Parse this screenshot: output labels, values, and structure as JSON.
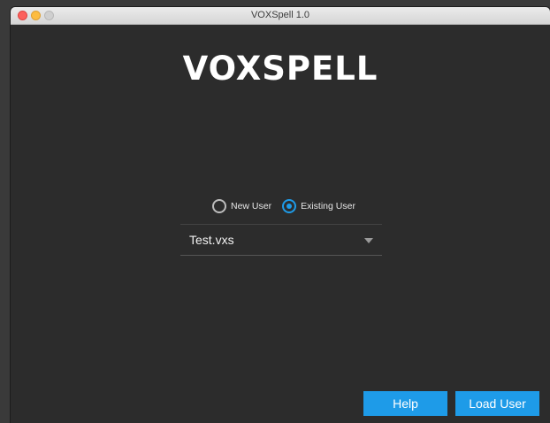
{
  "window": {
    "title": "VOXSpell 1.0"
  },
  "logo": {
    "text": "VOXSPELL"
  },
  "user_mode": {
    "options": [
      {
        "label": "New User",
        "selected": false
      },
      {
        "label": "Existing User",
        "selected": true
      }
    ]
  },
  "user_select": {
    "value": "Test.vxs"
  },
  "buttons": {
    "help_label": "Help",
    "load_label": "Load User"
  },
  "colors": {
    "accent": "#1e9be8",
    "background": "#2c2c2c"
  }
}
